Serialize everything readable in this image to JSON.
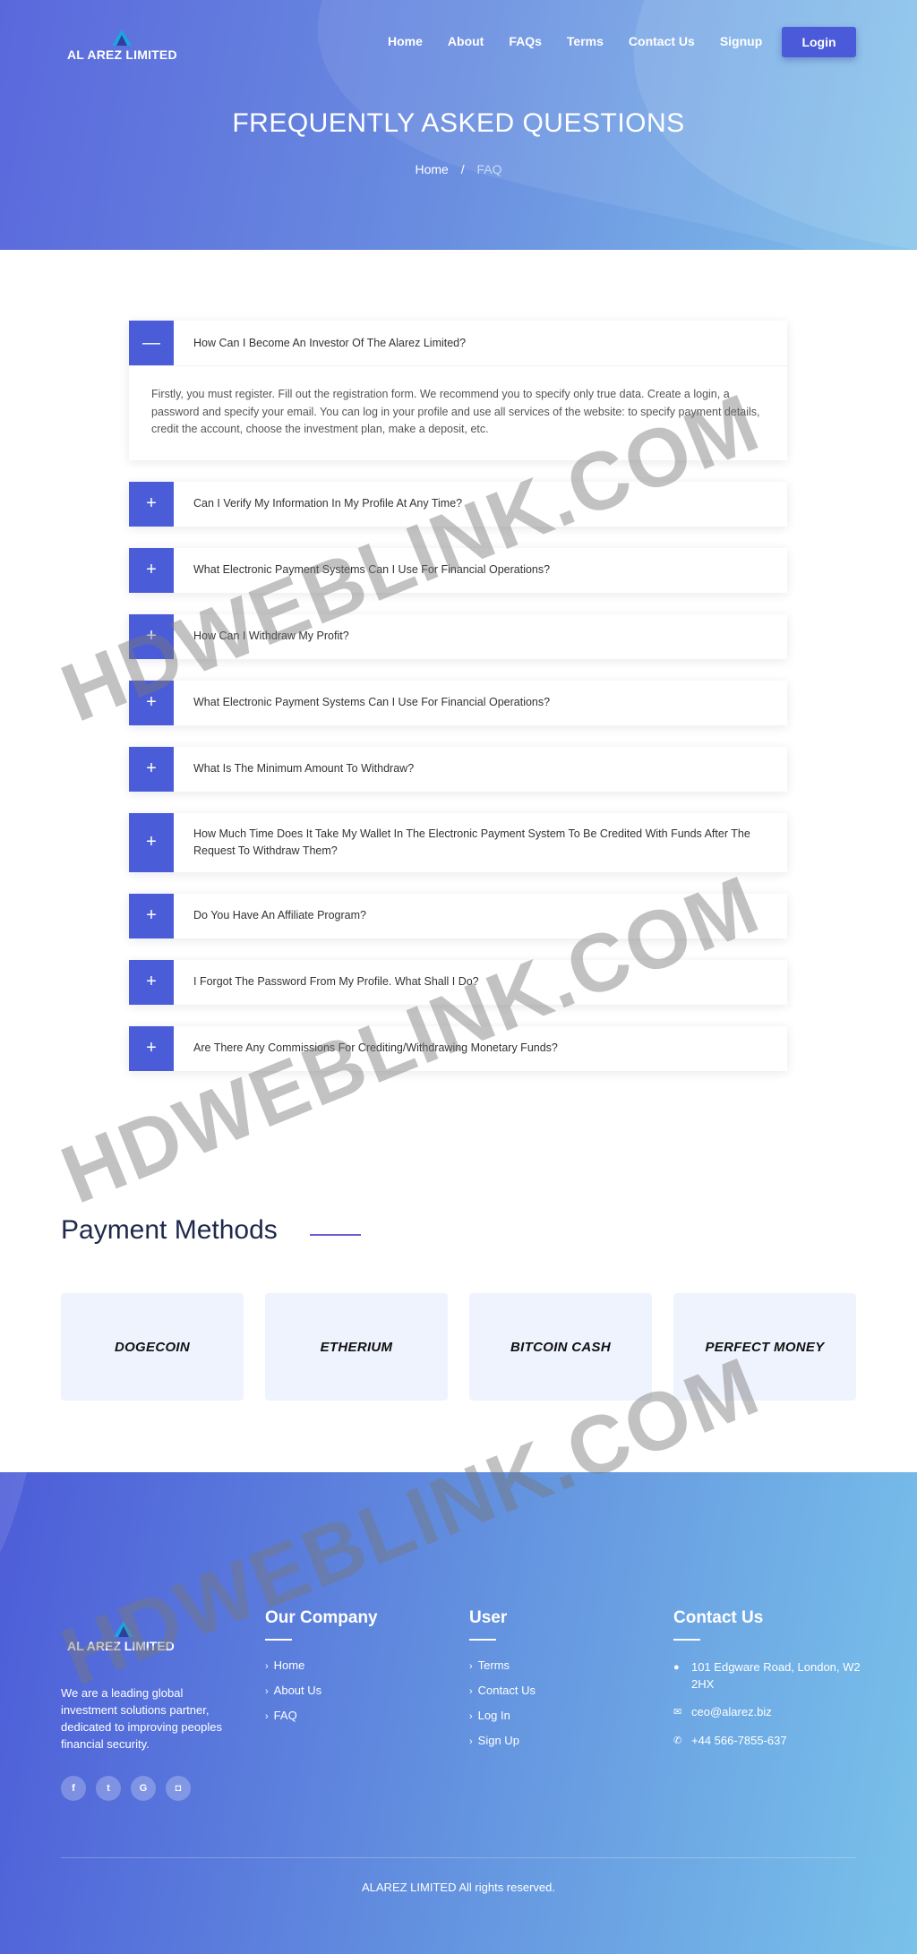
{
  "brand": {
    "name": "AL AREZ LIMITED"
  },
  "nav": {
    "items": [
      "Home",
      "About",
      "FAQs",
      "Terms",
      "Contact Us",
      "Signup"
    ],
    "login_label": "Login"
  },
  "hero": {
    "title": "FREQUENTLY ASKED QUESTIONS",
    "breadcrumb": {
      "home": "Home",
      "separator": "/",
      "current": "FAQ"
    }
  },
  "faq": {
    "items": [
      {
        "question": "How Can I Become An Investor Of The Alarez Limited?",
        "open": true,
        "answer": "Firstly, you must register. Fill out the registration form. We recommend you to specify only true data. Create a login, a password and specify your email. You can log in your profile and use all services of the website: to specify payment details, credit the account, choose the investment plan, make a deposit, etc.",
        "toggle": "—"
      },
      {
        "question": "Can I Verify My Information In My Profile At Any Time?",
        "toggle": "+"
      },
      {
        "question": "What Electronic Payment Systems Can I Use For Financial Operations?",
        "toggle": "+"
      },
      {
        "question": "How Can I Withdraw My Profit?",
        "toggle": "+"
      },
      {
        "question": "What Electronic Payment Systems Can I Use For Financial Operations?",
        "toggle": "+"
      },
      {
        "question": "What Is The Minimum Amount To Withdraw?",
        "toggle": "+"
      },
      {
        "question": "How Much Time Does It Take My Wallet In The Electronic Payment System To Be Credited With Funds After The Request To Withdraw Them?",
        "toggle": "+"
      },
      {
        "question": "Do You Have An Affiliate Program?",
        "toggle": "+"
      },
      {
        "question": "I Forgot The Password From My Profile. What Shall I Do?",
        "toggle": "+"
      },
      {
        "question": "Are There Any Commissions For Crediting/Withdrawing Monetary Funds?",
        "toggle": "+"
      }
    ]
  },
  "payment": {
    "title": "Payment Methods",
    "methods": [
      "DOGECOIN",
      "ETHERIUM",
      "BITCOIN CASH",
      "PERFECT MONEY"
    ]
  },
  "footer": {
    "brand": "AL AREZ LIMITED",
    "about": "We are a leading global investment solutions partner, dedicated to improving peoples financial security.",
    "socials": [
      {
        "icon": "facebook-icon",
        "glyph": "f"
      },
      {
        "icon": "twitter-icon",
        "glyph": "t"
      },
      {
        "icon": "google-icon",
        "glyph": "G"
      },
      {
        "icon": "instagram-icon",
        "glyph": "◘"
      }
    ],
    "company": {
      "title": "Our Company",
      "links": [
        "Home",
        "About Us",
        "FAQ"
      ]
    },
    "user": {
      "title": "User",
      "links": [
        "Terms",
        "Contact Us",
        "Log In",
        "Sign Up"
      ]
    },
    "contact": {
      "title": "Contact Us",
      "address": "101 Edgware Road, London, W2 2HX",
      "email": "ceo@alarez.biz",
      "phone": "+44 566-7855-637"
    },
    "copyright": "ALAREZ LIMITED All rights reserved."
  },
  "watermark": "HDWEBLINK.COM",
  "colors": {
    "accent": "#4b5cd8",
    "hero_start": "#5a68dc",
    "hero_end": "#7fc1ea",
    "method_bg": "#eef3fe"
  }
}
